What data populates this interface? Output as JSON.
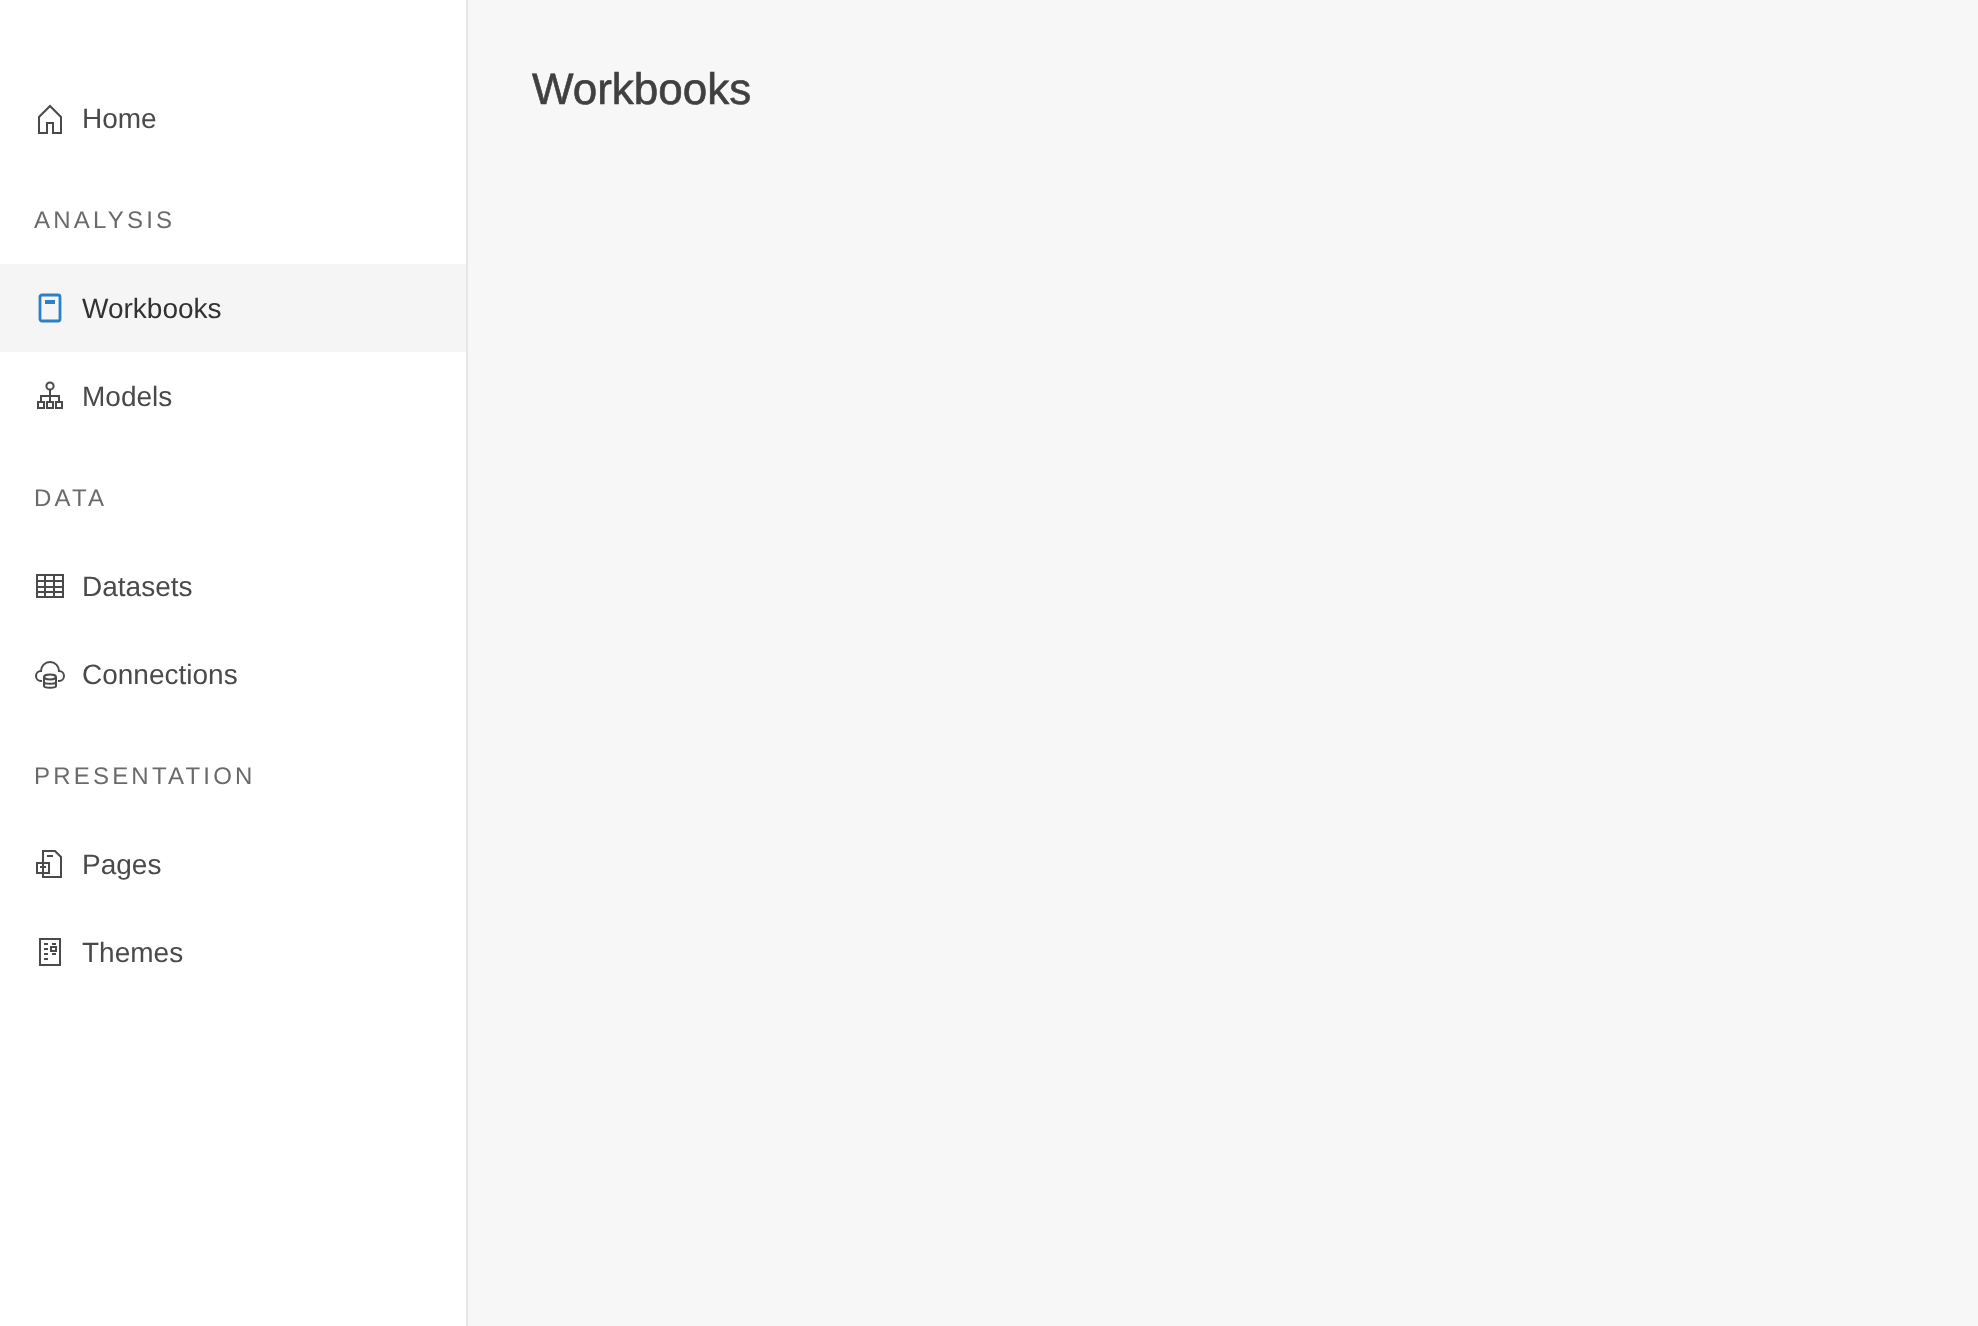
{
  "sidebar": {
    "top_items": [
      {
        "label": "Home",
        "selected": false
      }
    ],
    "sections": [
      {
        "title": "ANALYSIS",
        "items": [
          {
            "label": "Workbooks",
            "selected": true
          },
          {
            "label": "Models",
            "selected": false
          }
        ]
      },
      {
        "title": "DATA",
        "items": [
          {
            "label": "Datasets",
            "selected": false
          },
          {
            "label": "Connections",
            "selected": false
          }
        ]
      },
      {
        "title": "PRESENTATION",
        "items": [
          {
            "label": "Pages",
            "selected": false
          },
          {
            "label": "Themes",
            "selected": false
          }
        ]
      }
    ]
  },
  "main": {
    "title": "Workbooks"
  }
}
